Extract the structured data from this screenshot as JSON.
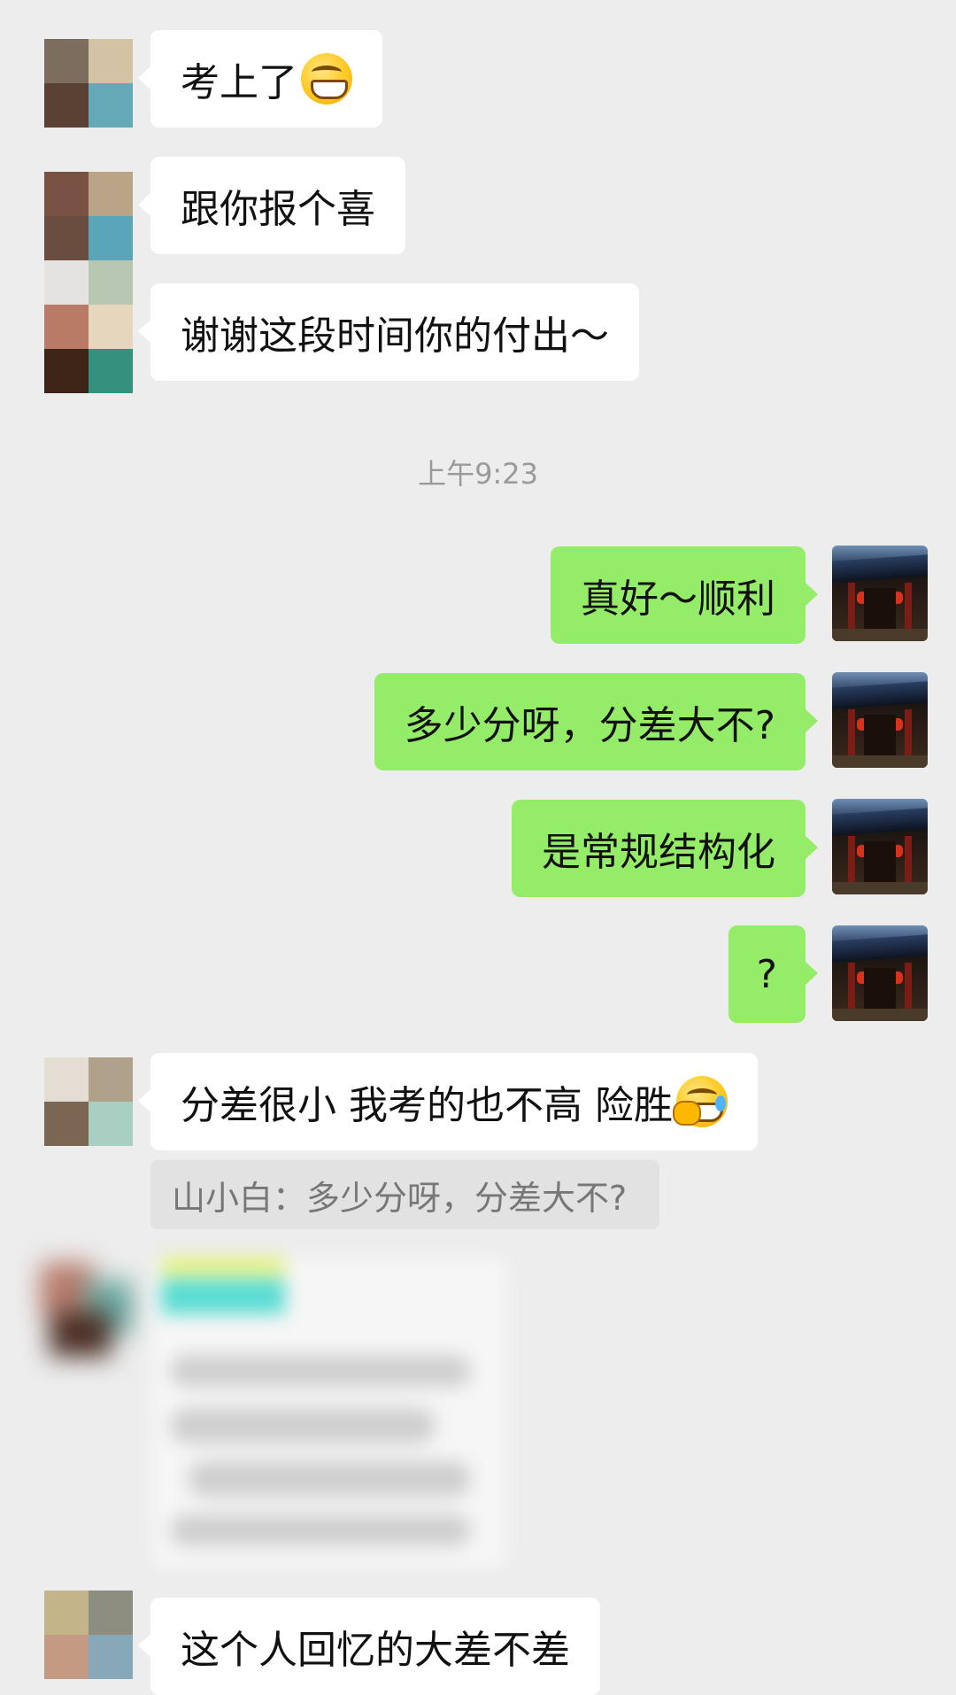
{
  "messages": {
    "m1": "考上了",
    "m2": "跟你报个喜",
    "m3": "谢谢这段时间你的付出～",
    "time": "上午9:23",
    "r1": "真好～顺利",
    "r2": "多少分呀，分差大不?",
    "r3": "是常规结构化",
    "r4": "?",
    "m4": "分差很小 我考的也不高 险胜",
    "quote": "山小白：多少分呀，分差大不?",
    "m5": "这个人回忆的大差不差"
  },
  "icons": {
    "grin": "grinning-face-emoji",
    "laugh": "rolling-laughing-emoji",
    "avatar_self": "temple-photo-avatar"
  },
  "colors": {
    "background": "#ededed",
    "bubble_in": "#ffffff",
    "bubble_out": "#95ec69",
    "timestamp": "#9a9a9a"
  }
}
